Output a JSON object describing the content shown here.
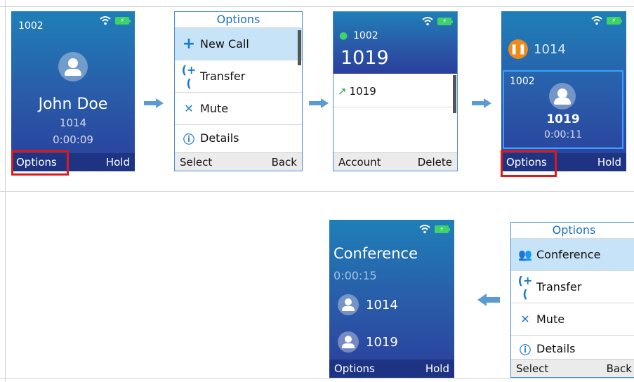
{
  "status": {
    "wifi_icon": "wifi-icon",
    "battery_icon": "battery-charging-icon"
  },
  "screen1": {
    "account": "1002",
    "name": "John Doe",
    "number": "1014",
    "duration": "0:00:09",
    "softkeys": {
      "left": "Options",
      "right": "Hold"
    }
  },
  "screen2": {
    "title": "Options",
    "items": [
      {
        "label": "New Call",
        "icon": "plus-icon"
      },
      {
        "label": "Transfer",
        "icon": "transfer-icon"
      },
      {
        "label": "Mute",
        "icon": "mute-icon"
      },
      {
        "label": "Details",
        "icon": "info-icon"
      }
    ],
    "softkeys": {
      "left": "Select",
      "right": "Back"
    }
  },
  "screen3": {
    "account": "1002",
    "dial_input": "1019",
    "suggestion": "1019",
    "softkeys": {
      "left": "Account",
      "right": "Delete"
    }
  },
  "screen4": {
    "held_number": "1014",
    "account": "1002",
    "number": "1019",
    "duration": "0:00:11",
    "softkeys": {
      "left": "Options",
      "right": "Hold"
    }
  },
  "screen5": {
    "title": "Conference",
    "duration": "0:00:15",
    "participants": [
      "1014",
      "1019"
    ],
    "softkeys": {
      "left": "Options",
      "right": "Hold"
    }
  },
  "screen6": {
    "title": "Options",
    "items": [
      {
        "label": "Conference",
        "icon": "conference-icon"
      },
      {
        "label": "Transfer",
        "icon": "transfer-icon"
      },
      {
        "label": "Mute",
        "icon": "mute-icon"
      },
      {
        "label": "Details",
        "icon": "info-icon"
      }
    ],
    "softkeys": {
      "left": "Select",
      "right": "Back"
    }
  },
  "colors": {
    "accent": "#1a6fc2",
    "highlight": "#e01818",
    "arrow": "#5b9bd5"
  }
}
